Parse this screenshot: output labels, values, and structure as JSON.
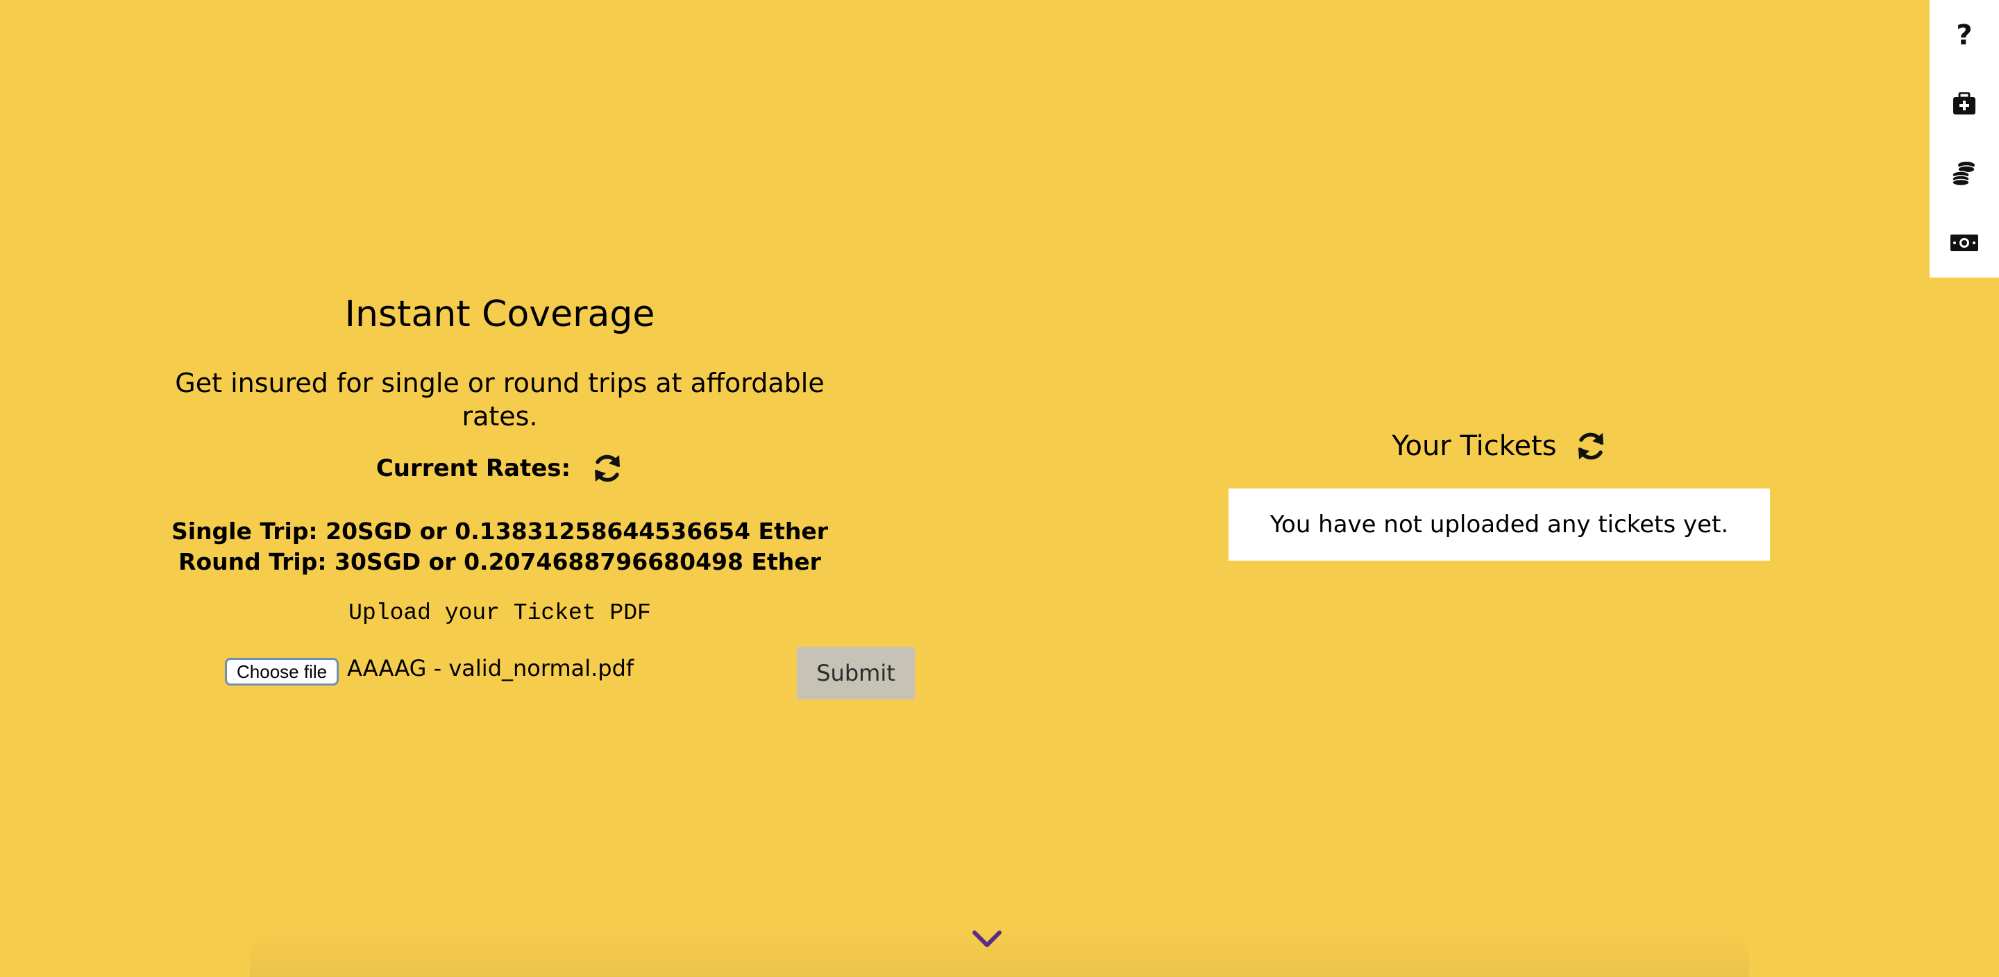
{
  "toolbar": {
    "items": [
      {
        "icon": "question-icon"
      },
      {
        "icon": "medical-kit-icon"
      },
      {
        "icon": "coins-icon"
      },
      {
        "icon": "money-bill-icon"
      }
    ]
  },
  "coverage": {
    "title": "Instant Coverage",
    "subtitle": "Get insured for single or round trips at affordable rates.",
    "rates_label": "Current Rates:",
    "single_trip": "Single Trip: 20SGD or 0.13831258644536654 Ether",
    "round_trip": "Round Trip: 30SGD or 0.2074688796680498 Ether",
    "upload_label": "Upload your Ticket PDF",
    "choose_file_label": "Choose file",
    "file_name": "AAAAG - valid_normal.pdf",
    "submit_label": "Submit"
  },
  "tickets": {
    "title": "Your Tickets",
    "empty_message": "You have not uploaded any tickets yet."
  },
  "colors": {
    "background": "#f6cc4d",
    "chevron": "#5b2a86"
  }
}
